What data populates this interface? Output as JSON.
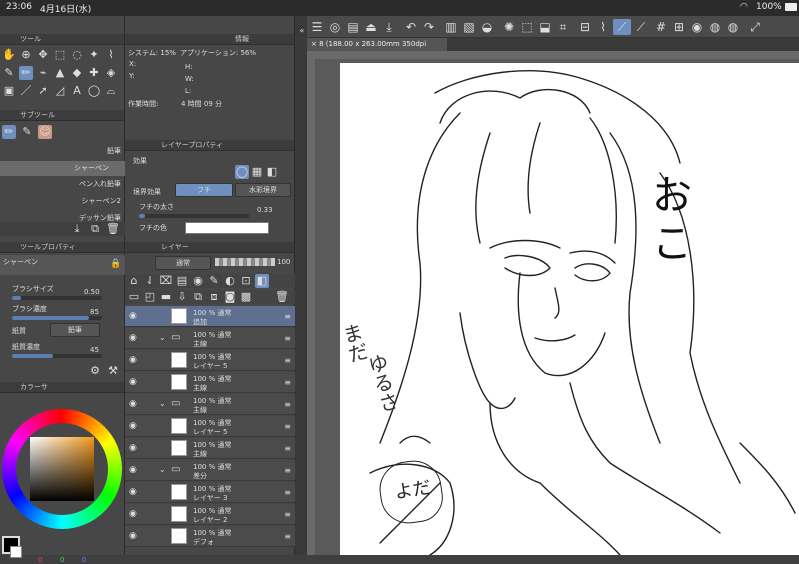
{
  "status": {
    "time": "23:06",
    "date": "4月16日(水)",
    "battery": "100%"
  },
  "tool_panel": {
    "title": "ツール"
  },
  "subtool_panel": {
    "title": "サブツール",
    "items": [
      "鉛筆",
      "シャーペン",
      "ペン入れ鉛筆",
      "シャーペン2",
      "デッサン鉛筆"
    ]
  },
  "tool_property": {
    "title": "ツールプロパティ",
    "tool_name": "シャーペン",
    "brush_size_label": "ブラシサイズ",
    "brush_size": "0.50",
    "brush_density_label": "ブラシ濃度",
    "brush_density": "85",
    "paper_label": "紙質",
    "paper_value": "鉛筆",
    "paper_density_label": "紙質濃度",
    "paper_density": "45"
  },
  "color_panel": {
    "title": "カラーサ",
    "values": [
      "0",
      "0",
      "0"
    ]
  },
  "info_panel": {
    "title": "情報",
    "system": "システム: 15%",
    "app": "アプリケーション: 56%",
    "x_label": "X:",
    "y_label": "Y:",
    "h_label": "H:",
    "w_label": "W:",
    "l_label": "L:",
    "work_time_label": "作業時間:",
    "work_time": "4 時間 09 分"
  },
  "layer_property": {
    "title": "レイヤープロパティ",
    "effect_label": "効果",
    "border_effect_label": "境界効果",
    "fuchi": "フチ",
    "watercolor": "水彩境界",
    "fuchi_thickness_label": "フチの太さ",
    "fuchi_thickness": "0.33",
    "fuchi_color_label": "フチの色"
  },
  "layer_panel": {
    "title": "レイヤー",
    "blend_mode": "通常",
    "opacity": "100",
    "layers": [
      {
        "l1": "100 % 通常",
        "l2": "追加",
        "folder": false
      },
      {
        "l1": "100 % 通常",
        "l2": "主線",
        "folder": true
      },
      {
        "l1": "100 % 通常",
        "l2": "レイヤー 5",
        "folder": false
      },
      {
        "l1": "100 % 通常",
        "l2": "主線",
        "folder": false
      },
      {
        "l1": "100 % 通常",
        "l2": "主線",
        "folder": true
      },
      {
        "l1": "100 % 通常",
        "l2": "レイヤー 5",
        "folder": false
      },
      {
        "l1": "100 % 通常",
        "l2": "主線",
        "folder": false
      },
      {
        "l1": "100 % 通常",
        "l2": "差分",
        "folder": true
      },
      {
        "l1": "100 % 通常",
        "l2": "レイヤー 3",
        "folder": false
      },
      {
        "l1": "100 % 通常",
        "l2": "レイヤー 2",
        "folder": false
      },
      {
        "l1": "100 % 通常",
        "l2": "デフォ",
        "folder": false
      }
    ]
  },
  "document": {
    "tab": "8 (188.00 x 263.00mm 350dpi 130.1%)"
  },
  "canvas_text": {
    "oko_1": "お",
    "oko_2": "こ",
    "side_1": "まだ",
    "side_2": "ゆるさ",
    "bubble": "よだ"
  }
}
